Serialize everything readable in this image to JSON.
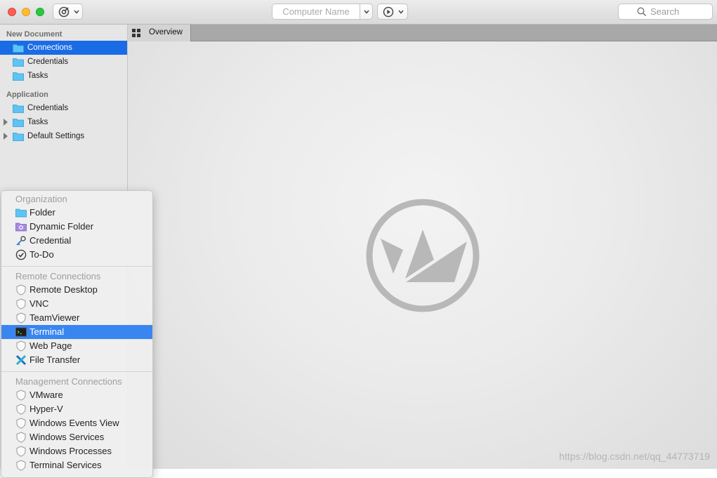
{
  "toolbar": {
    "computer_name_placeholder": "Computer Name",
    "search_label": "Search"
  },
  "sidebar": {
    "sections": [
      {
        "header": "New Document",
        "items": [
          {
            "label": "Connections",
            "selected": true
          },
          {
            "label": "Credentials"
          },
          {
            "label": "Tasks"
          }
        ]
      },
      {
        "header": "Application",
        "items": [
          {
            "label": "Credentials"
          },
          {
            "label": "Tasks",
            "expandable": true
          },
          {
            "label": "Default Settings",
            "expandable": true
          }
        ]
      }
    ]
  },
  "tabs": [
    {
      "label": "Overview",
      "icon": "grid-icon"
    }
  ],
  "menu": {
    "groups": [
      {
        "header": "Organization",
        "items": [
          {
            "label": "Folder",
            "icon": "folder-icon"
          },
          {
            "label": "Dynamic Folder",
            "icon": "dynamic-folder-icon"
          },
          {
            "label": "Credential",
            "icon": "key-icon"
          },
          {
            "label": "To-Do",
            "icon": "checkmark-circle-icon"
          }
        ]
      },
      {
        "header": "Remote Connections",
        "items": [
          {
            "label": "Remote Desktop",
            "icon": "shield-icon"
          },
          {
            "label": "VNC",
            "icon": "shield-icon"
          },
          {
            "label": "TeamViewer",
            "icon": "shield-icon"
          },
          {
            "label": "Terminal",
            "icon": "terminal-icon",
            "highlighted": true
          },
          {
            "label": "Web Page",
            "icon": "shield-icon"
          },
          {
            "label": "File Transfer",
            "icon": "file-transfer-icon"
          }
        ]
      },
      {
        "header": "Management Connections",
        "items": [
          {
            "label": "VMware",
            "icon": "shield-icon"
          },
          {
            "label": "Hyper-V",
            "icon": "shield-icon"
          },
          {
            "label": "Windows Events View",
            "icon": "shield-icon"
          },
          {
            "label": "Windows Services",
            "icon": "shield-icon"
          },
          {
            "label": "Windows Processes",
            "icon": "shield-icon"
          },
          {
            "label": "Terminal Services",
            "icon": "shield-icon"
          }
        ]
      }
    ]
  },
  "watermark": "https://blog.csdn.net/qq_44773719",
  "colors": {
    "selection": "#1a6ce6",
    "menu_highlight": "#3a86f0",
    "folder": "#5fc3f4"
  }
}
